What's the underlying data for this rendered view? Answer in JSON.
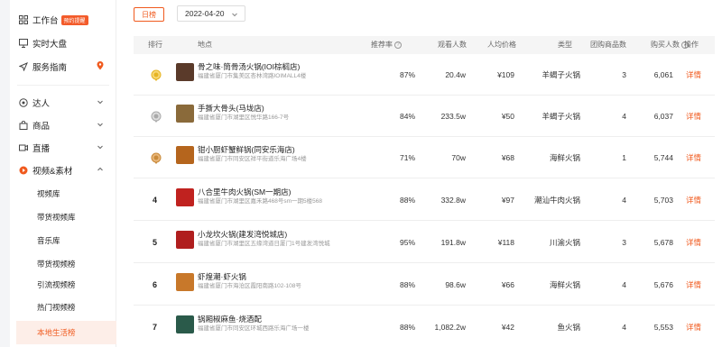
{
  "sidebar": {
    "workbench": {
      "label": "工作台",
      "badge": "预约提醒",
      "icon": "grid-icon"
    },
    "realtime": {
      "label": "实时大盘",
      "icon": "monitor-icon"
    },
    "service": {
      "label": "服务指南",
      "icon": "send-icon",
      "pin_icon": "location-pin-icon"
    },
    "expert": {
      "label": "达人",
      "icon": "target-icon"
    },
    "goods": {
      "label": "商品",
      "icon": "bag-icon"
    },
    "live": {
      "label": "直播",
      "icon": "video-icon"
    },
    "video": {
      "label": "视频&素材",
      "icon": "play-icon"
    },
    "sub_items": [
      {
        "label": "视频库"
      },
      {
        "label": "带货视频库"
      },
      {
        "label": "音乐库"
      },
      {
        "label": "带货视频榜"
      },
      {
        "label": "引流视频榜"
      },
      {
        "label": "热门视频榜"
      },
      {
        "label": "本地生活榜"
      }
    ],
    "accent": "#f05a1e"
  },
  "toolbar": {
    "day_button": "日榜",
    "date": "2022-04-20"
  },
  "table": {
    "headers": {
      "rank": "排行",
      "place": "地点",
      "recommend": "推荐率",
      "views": "观看人数",
      "price": "人均价格",
      "type": "类型",
      "deals": "团购商品数",
      "buyers": "购买人数",
      "action": "操作"
    },
    "rows": [
      {
        "rank": "1",
        "rank_icon": "gold-medal-icon",
        "name": "骨之味·筒骨汤火锅(IOI棕榈店)",
        "address": "福建省厦门市集美区杏林湾路IOIMALL4楼",
        "recommend": "87%",
        "views": "20.4w",
        "price": "¥109",
        "type": "羊蝎子火锅",
        "deals": "3",
        "buyers": "6,061",
        "action": "详情",
        "thumb_color": "#5a3a2a"
      },
      {
        "rank": "2",
        "rank_icon": "silver-medal-icon",
        "name": "手撕大骨头(马垅店)",
        "address": "福建省厦门市湖里区悦华路166-7号",
        "recommend": "84%",
        "views": "233.5w",
        "price": "¥50",
        "type": "羊蝎子火锅",
        "deals": "4",
        "buyers": "6,037",
        "action": "详情",
        "thumb_color": "#8a6a3a"
      },
      {
        "rank": "3",
        "rank_icon": "bronze-medal-icon",
        "name": "钳小厨虾蟹鲜锅(同安乐海店)",
        "address": "福建省厦门市同安区祥平街道乐海广场4楼",
        "recommend": "71%",
        "views": "70w",
        "price": "¥68",
        "type": "海鲜火锅",
        "deals": "1",
        "buyers": "5,744",
        "action": "详情",
        "thumb_color": "#b5651d"
      },
      {
        "rank": "4",
        "rank_icon": "",
        "name": "八合里牛肉火锅(SM一期店)",
        "address": "福建省厦门市湖里区嘉禾路468号sm一期5楼568",
        "recommend": "88%",
        "views": "332.8w",
        "price": "¥97",
        "type": "潮汕牛肉火锅",
        "deals": "4",
        "buyers": "5,703",
        "action": "详情",
        "thumb_color": "#c0221f"
      },
      {
        "rank": "5",
        "rank_icon": "",
        "name": "小龙坎火锅(建发湾悦城店)",
        "address": "福建省厦门市湖里区五缘湾道日厦门1号建发湾悦城",
        "recommend": "95%",
        "views": "191.8w",
        "price": "¥118",
        "type": "川渝火锅",
        "deals": "3",
        "buyers": "5,678",
        "action": "详情",
        "thumb_color": "#b01e1e"
      },
      {
        "rank": "6",
        "rank_icon": "",
        "name": "虾煌潮·虾火锅",
        "address": "福建省厦门市海沧区霞阳南路102-108号",
        "recommend": "88%",
        "views": "98.6w",
        "price": "¥66",
        "type": "海鲜火锅",
        "deals": "4",
        "buyers": "5,676",
        "action": "详情",
        "thumb_color": "#c8782a"
      },
      {
        "rank": "7",
        "rank_icon": "",
        "name": "锅厢椒麻鱼·烧酒配",
        "address": "福建省厦门市同安区环城西路乐海广场一楼",
        "recommend": "88%",
        "views": "1,082.2w",
        "price": "¥42",
        "type": "鱼火锅",
        "deals": "4",
        "buyers": "5,553",
        "action": "详情",
        "thumb_color": "#2a5a4a"
      }
    ]
  }
}
